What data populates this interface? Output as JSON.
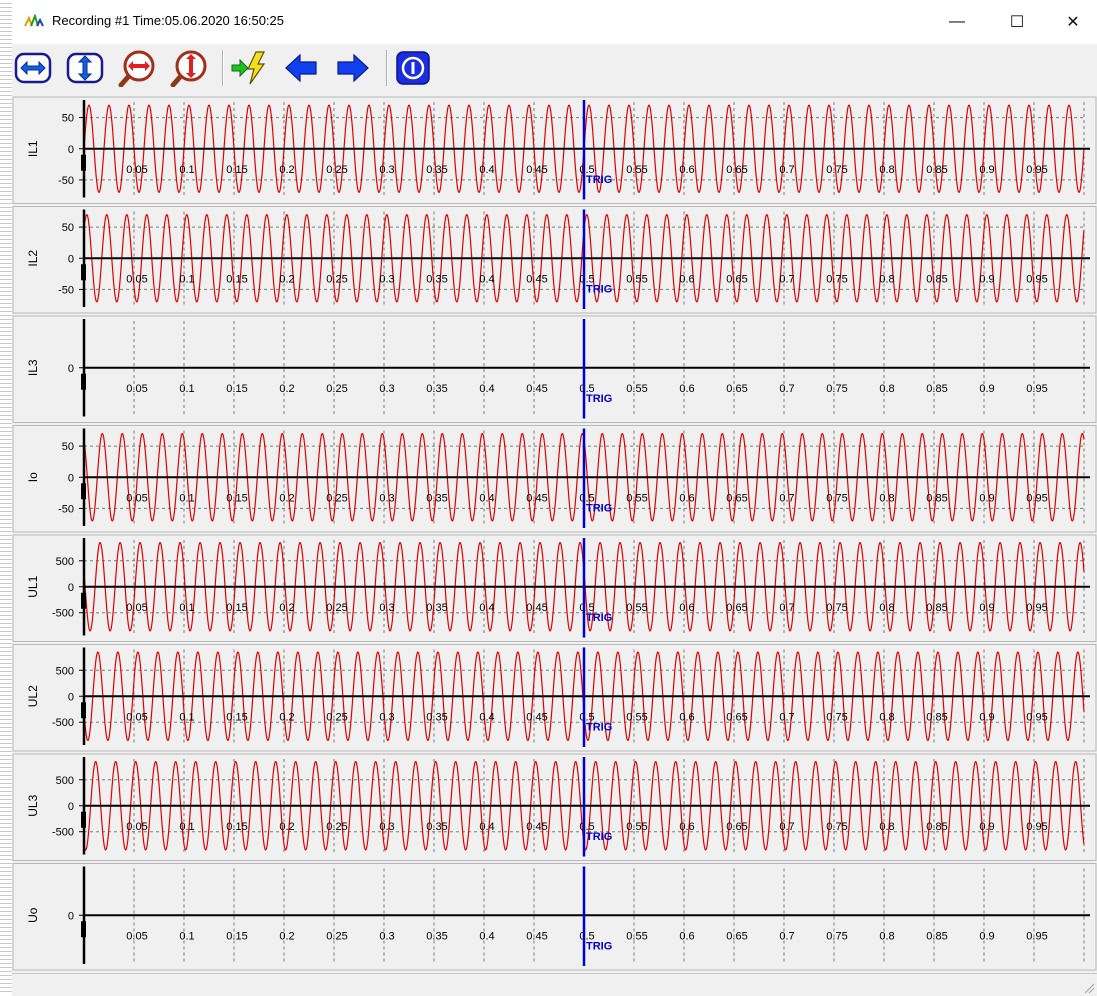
{
  "window": {
    "title": "Recording #1 Time:05.06.2020 16:50:25",
    "minimize_label": "—",
    "maximize_label": "☐",
    "close_label": "✕"
  },
  "toolbar": {
    "buttons": [
      {
        "icon": "horizontal-fit-icon"
      },
      {
        "icon": "vertical-fit-icon"
      },
      {
        "icon": "zoom-horizontal-icon"
      },
      {
        "icon": "zoom-vertical-icon"
      },
      {
        "icon": "go-to-trigger-icon"
      },
      {
        "icon": "arrow-left-icon"
      },
      {
        "icon": "arrow-right-icon"
      },
      {
        "icon": "info-icon"
      }
    ]
  },
  "colors": {
    "signal": "#e00000",
    "trigger": "#0000d0",
    "axis": "#000000",
    "grid": "#7a7a7a",
    "panel_bg": "#f0f0f0"
  },
  "chart_data": {
    "type": "line",
    "x_ticks": [
      "0.05",
      "0.1",
      "0.15",
      "0.2",
      "0.25",
      "0.3",
      "0.35",
      "0.4",
      "0.45",
      "0.5",
      "0.55",
      "0.6",
      "0.65",
      "0.7",
      "0.75",
      "0.8",
      "0.85",
      "0.9",
      "0.95"
    ],
    "xlim": [
      0,
      1.0
    ],
    "trigger": {
      "x": 0.5,
      "label": "TRIG"
    },
    "frequency_hz": 50,
    "channels": [
      {
        "name": "IL1",
        "yticks": [
          "50",
          "0",
          "-50"
        ],
        "ytick_values": [
          50,
          0,
          -50
        ],
        "ylim": [
          -75,
          75
        ],
        "amplitude": 70
      },
      {
        "name": "IL2",
        "yticks": [
          "50",
          "0",
          "-50"
        ],
        "ytick_values": [
          50,
          0,
          -50
        ],
        "ylim": [
          -75,
          75
        ],
        "amplitude": 70
      },
      {
        "name": "IL3",
        "yticks": [
          "0"
        ],
        "ytick_values": [
          0
        ],
        "ylim": [
          -75,
          75
        ],
        "amplitude": 0
      },
      {
        "name": "Io",
        "yticks": [
          "50",
          "0",
          "-50"
        ],
        "ytick_values": [
          50,
          0,
          -50
        ],
        "ylim": [
          -75,
          75
        ],
        "amplitude": 70
      },
      {
        "name": "UL1",
        "yticks": [
          "500",
          "0",
          "-500"
        ],
        "ytick_values": [
          500,
          0,
          -500
        ],
        "ylim": [
          -900,
          900
        ],
        "amplitude": 850
      },
      {
        "name": "UL2",
        "yticks": [
          "500",
          "0",
          "-500"
        ],
        "ytick_values": [
          500,
          0,
          -500
        ],
        "ylim": [
          -900,
          900
        ],
        "amplitude": 850
      },
      {
        "name": "UL3",
        "yticks": [
          "500",
          "0",
          "-500"
        ],
        "ytick_values": [
          500,
          0,
          -500
        ],
        "ylim": [
          -900,
          900
        ],
        "amplitude": 850
      },
      {
        "name": "Uo",
        "yticks": [
          "0"
        ],
        "ytick_values": [
          0
        ],
        "ylim": [
          -900,
          900
        ],
        "amplitude": 0
      }
    ]
  }
}
